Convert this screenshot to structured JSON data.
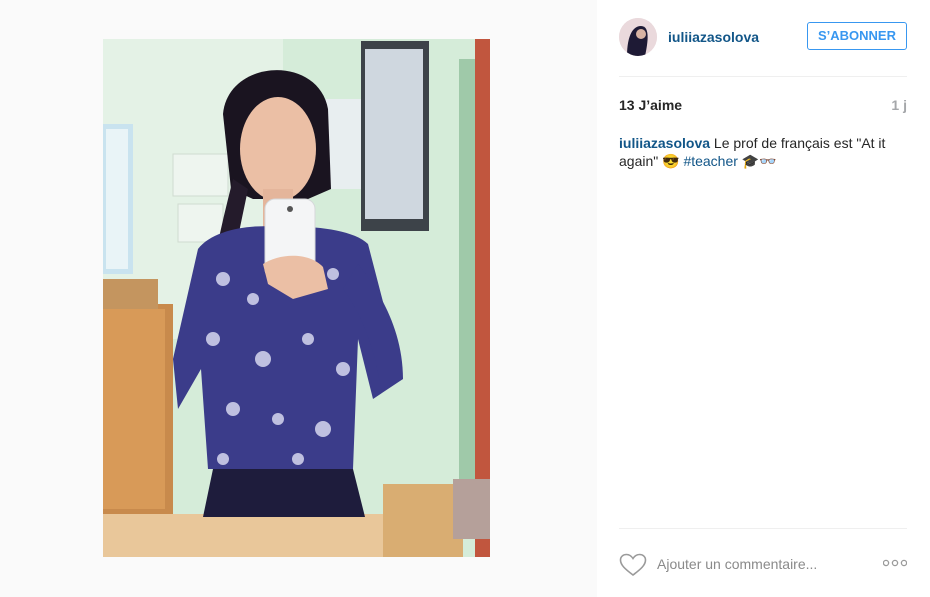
{
  "post": {
    "username": "iuliiazasolova",
    "follow_label": "S’ABONNER",
    "likes": "13 J’aime",
    "time_ago": "1 j",
    "caption": {
      "username": "iuliiazasolova",
      "text": " Le prof de français est \"At it again\" 😎 ",
      "hashtag": "#teacher",
      "emojis": " 🎓👓"
    },
    "comment_placeholder": "Ajouter un commentaire...",
    "more_icon": "more-options-icon",
    "like_icon": "heart-icon"
  },
  "colors": {
    "username": "#125688",
    "follow_button": "#3897f0",
    "meta_grey": "#a5a7aa"
  }
}
